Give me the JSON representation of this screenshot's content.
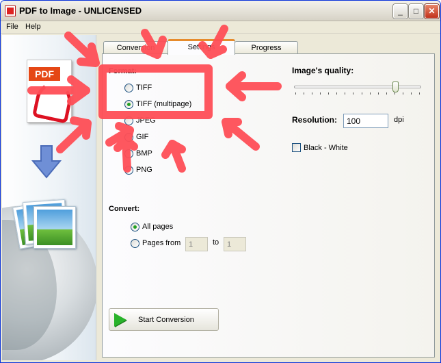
{
  "window": {
    "title": "PDF to Image - UNLICENSED"
  },
  "menu": {
    "file": "File",
    "help": "Help"
  },
  "tabs": {
    "conversion": "Conversion",
    "settings": "Settings",
    "progress": "Progress"
  },
  "format": {
    "label": "Format:",
    "options": [
      "TIFF",
      "TIFF (multipage)",
      "JPEG",
      "GIF",
      "BMP",
      "PNG"
    ],
    "selected": "TIFF (multipage)"
  },
  "quality": {
    "label": "Image's quality:",
    "level_fraction": 0.8
  },
  "resolution": {
    "label": "Resolution:",
    "value": "100",
    "unit": "dpi"
  },
  "black_white": {
    "label": "Black - White",
    "checked": false
  },
  "convert": {
    "label": "Convert:",
    "all_pages": "All pages",
    "pages_from": "Pages from",
    "from_value": "1",
    "to_label": "to",
    "to_value": "1",
    "selected": "All pages"
  },
  "actions": {
    "start": "Start Conversion"
  },
  "icons": {
    "left_panel": [
      "pdf-document-icon",
      "arrow-down-icon",
      "image-stack-icon",
      "globe-icon"
    ],
    "start": "play-icon"
  },
  "colors": {
    "active_tab_accent": "#e68b2c",
    "annotation_red": "#ff4f57",
    "radio_dot": "#21a121"
  }
}
